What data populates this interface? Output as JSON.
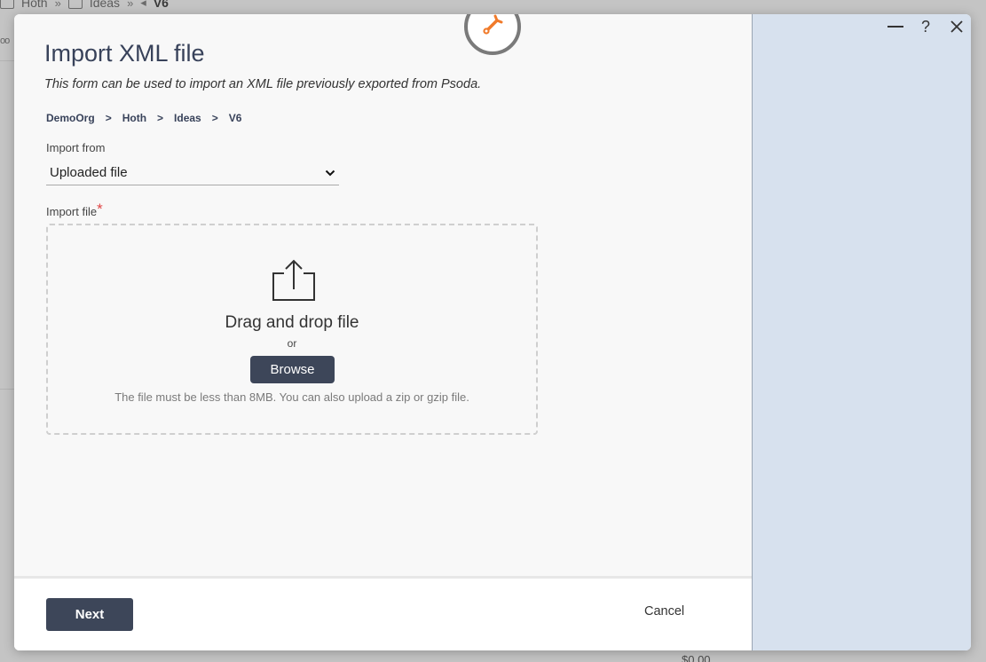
{
  "background": {
    "breadcrumb": [
      "Hoth",
      "Ideas",
      "V6"
    ],
    "amount": "$0.00"
  },
  "modal": {
    "title": "Import XML file",
    "subtitle": "This form can be used to import an XML file previously exported from Psoda.",
    "breadcrumb": [
      "DemoOrg",
      "Hoth",
      "Ideas",
      "V6"
    ],
    "import_from": {
      "label": "Import from",
      "value": "Uploaded file"
    },
    "import_file": {
      "label": "Import file",
      "required_mark": "*",
      "dropzone_title": "Drag and drop file",
      "or_text": "or",
      "browse_label": "Browse",
      "hint": "The file must be less than 8MB. You can also upload a zip or gzip file."
    },
    "footer": {
      "next_label": "Next",
      "cancel_label": "Cancel"
    },
    "window_controls": {
      "help_label": "?"
    }
  },
  "colors": {
    "primary_button": "#3d4659",
    "side_panel": "#d7e1ee",
    "required": "#e04545",
    "badge_accent": "#f07a2a"
  }
}
